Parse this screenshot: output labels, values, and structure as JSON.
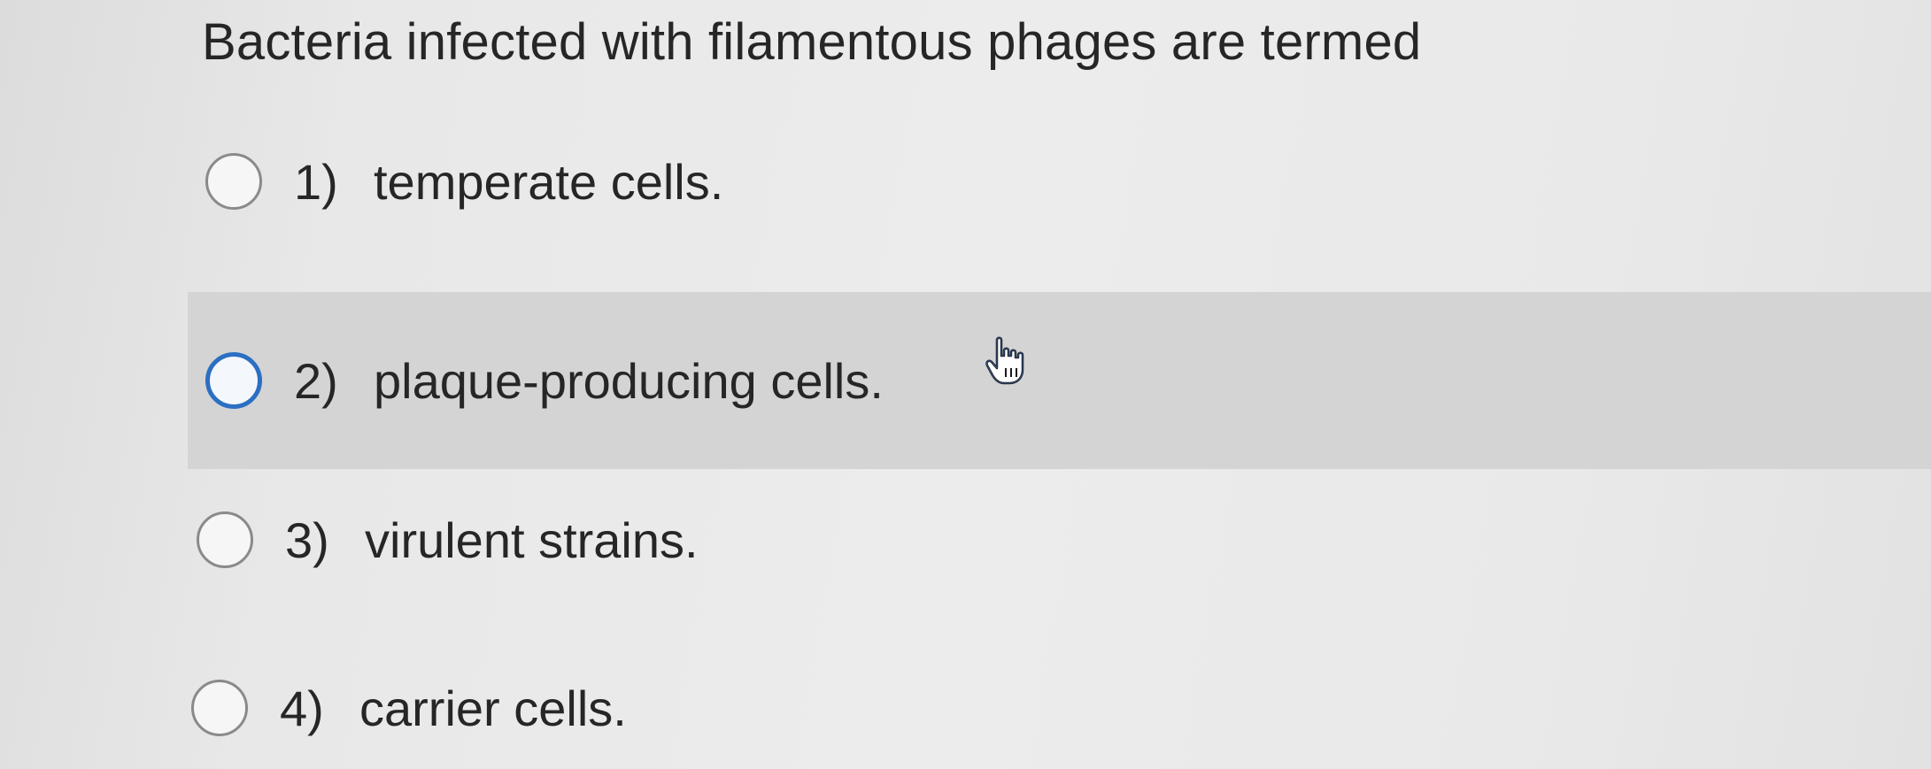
{
  "question": {
    "text": "Bacteria infected with filamentous phages are termed"
  },
  "options": [
    {
      "number": "1)",
      "label": "temperate cells.",
      "hovered": false
    },
    {
      "number": "2)",
      "label": "plaque-producing cells.",
      "hovered": true
    },
    {
      "number": "3)",
      "label": "virulent strains.",
      "hovered": false
    },
    {
      "number": "4)",
      "label": "carrier cells.",
      "hovered": false
    }
  ],
  "cursor": {
    "icon": "hand-pointer-icon"
  },
  "colors": {
    "background": "#e8e8e8",
    "hover_row": "#d4d4d4",
    "selected_radio_border": "#2b6fc2",
    "text": "#262626"
  }
}
